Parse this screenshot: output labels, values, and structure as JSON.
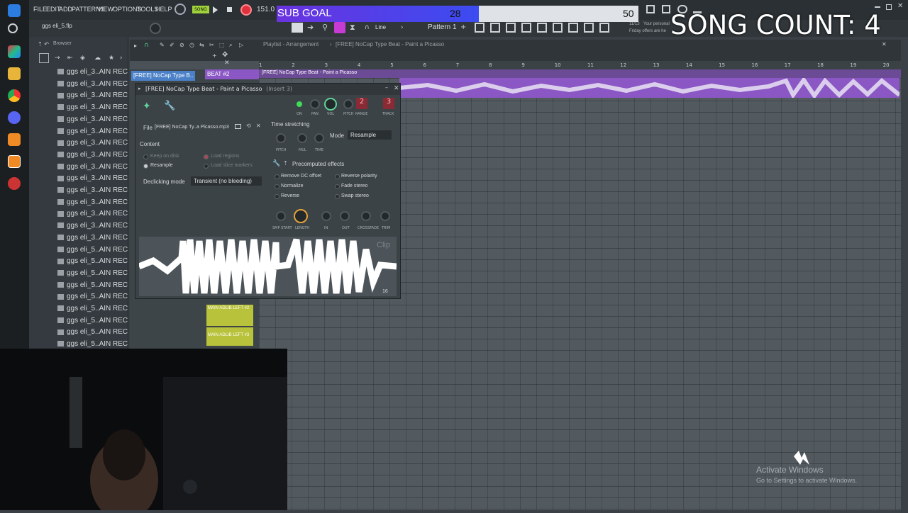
{
  "fl": {
    "menu": [
      "FILE",
      "EDIT",
      "ADD",
      "PATTERNS",
      "VIEW",
      "OPTIONS",
      "TOOLS",
      "HELP"
    ],
    "song_mode": "SONG",
    "tempo": "151.0",
    "project_file": "ggs eli_5.flp",
    "snap_mode": "Line",
    "pattern": "Pattern 1",
    "cpu_hint": "Friday offers are he",
    "news_hint": "Your personal",
    "news_date": "11/13"
  },
  "browser": {
    "title": "Browser",
    "items": [
      "ggs eli_3..AIN REC",
      "ggs eli_3..AIN REC",
      "ggs eli_3..AIN REC",
      "ggs eli_3..AIN REC",
      "ggs eli_3..AIN REC",
      "ggs eli_3..AIN REC",
      "ggs eli_3..AIN REC",
      "ggs eli_3..AIN REC",
      "ggs eli_3..AIN REC",
      "ggs eli_3..AIN REC",
      "ggs eli_3..AIN REC",
      "ggs eli_3..AIN REC",
      "ggs eli_3..AIN REC",
      "ggs eli_3..AIN REC",
      "ggs eli_3..AIN REC",
      "ggs eli_5..AIN REC",
      "ggs eli_5..AIN REC",
      "ggs eli_5..AIN REC",
      "ggs eli_5..AIN REC",
      "ggs eli_5..AIN REC",
      "ggs eli_5..AIN REC",
      "ggs eli_5..AIN REC",
      "ggs eli_5..AIN REC",
      "ggs eli_5..AIN REC"
    ]
  },
  "playlist": {
    "title": "Playlist - Arrangement",
    "clip_name": "[FREE] NoCap Type Beat - Paint a Picasso",
    "track_clip": "[FREE] NoCap Type B..",
    "beat_label": "BEAT #2",
    "ruler": [
      "1",
      "2",
      "3",
      "4",
      "5",
      "6",
      "7",
      "8",
      "9",
      "10",
      "11",
      "12",
      "13",
      "14",
      "15",
      "16",
      "17",
      "18",
      "19",
      "20"
    ],
    "adlib_clips": [
      "MAIN ADLIB LEFT #2",
      "MAIN ADLIB LEFT #3"
    ]
  },
  "channel": {
    "title": "[FREE] NoCap Type Beat - Paint a Picasso",
    "insert": "(Insert 3)",
    "knob_labels": [
      "ON",
      "PAN",
      "VOL",
      "PITCH",
      "RANGE",
      "TRACK"
    ],
    "range_value": "2",
    "track_value": "3",
    "file_label": "File",
    "file_name": "[FREE] NoCap Ty..a Picasso.mp3",
    "content_label": "Content",
    "keep_on_disk": "Keep on disk",
    "load_regions": "Load regions",
    "resample": "Resample",
    "load_slice_markers": "Load slice markers",
    "declicking_label": "Declicking mode",
    "declicking_value": "Transient (no bleeding)",
    "time_stretching": "Time stretching",
    "ts_knobs": [
      "PITCH",
      "MUL",
      "TIME"
    ],
    "mode_label": "Mode",
    "mode_value": "Resample",
    "precomputed": "Precomputed effects",
    "effects_left": [
      "Remove DC offset",
      "Normalize",
      "Reverse"
    ],
    "effects_right": [
      "Reverse polarity",
      "Fade stereo",
      "Swap stereo"
    ],
    "env_knobs": [
      "SMP START",
      "LENGTH",
      "IN",
      "OUT",
      "CROSSFADE",
      "TRIM"
    ],
    "clip_watermark": "Clip",
    "wave_number": "16"
  },
  "overlay": {
    "sub_goal": "SUB GOAL",
    "current": "28",
    "goal": "50",
    "song_count": "SONG COUNT: 4",
    "activate_title": "Activate Windows",
    "activate_sub": "Go to Settings to activate Windows."
  },
  "colors": {
    "accent_purple": "#8a57c4",
    "clip_green": "#b8c23a",
    "goal_fill": "#5a3ee6",
    "record_red": "#e0323c"
  }
}
